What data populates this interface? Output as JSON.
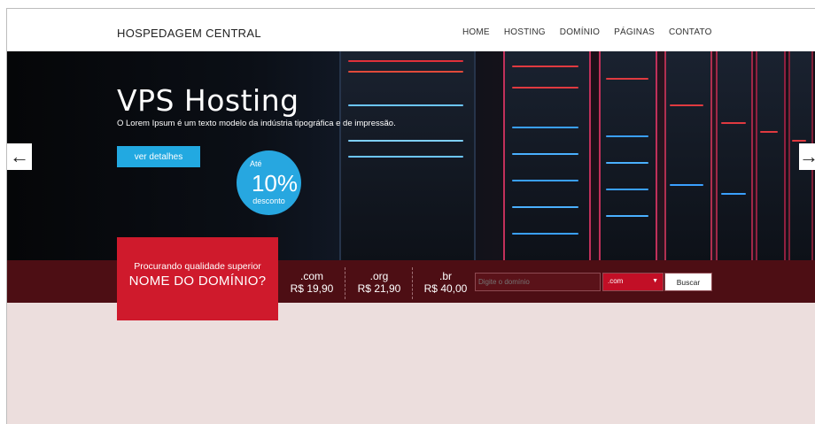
{
  "header": {
    "brand": "HOSPEDAGEM CENTRAL",
    "nav": [
      "HOME",
      "HOSTING",
      "DOMÍNIO",
      "PÁGINAS",
      "CONTATO"
    ]
  },
  "hero": {
    "title": "VPS Hosting",
    "subtitle": "O Lorem Ipsum é um texto modelo da indústria tipográfica e de impressão.",
    "button_label": "ver detalhes",
    "badge": {
      "top": "Até",
      "value": "10%",
      "bottom": "desconto"
    },
    "prev_arrow": "←",
    "next_arrow": "→"
  },
  "domain": {
    "promo_line1": "Procurando qualidade superior",
    "promo_line2": "NOME DO DOMÍNIO?",
    "tlds": [
      {
        "ext": ".com",
        "price": "R$ 19,90"
      },
      {
        "ext": ".org",
        "price": "R$ 21,90"
      },
      {
        "ext": ".br",
        "price": "R$ 40,00"
      }
    ],
    "input_placeholder": "Digite o domínio",
    "select_value": ".com",
    "search_label": "Buscar"
  },
  "colors": {
    "accent_blue": "#22a9e1",
    "promo_red": "#cf1a2c",
    "domain_bar": "#4d0e14",
    "page_bg": "#ecdedd"
  }
}
